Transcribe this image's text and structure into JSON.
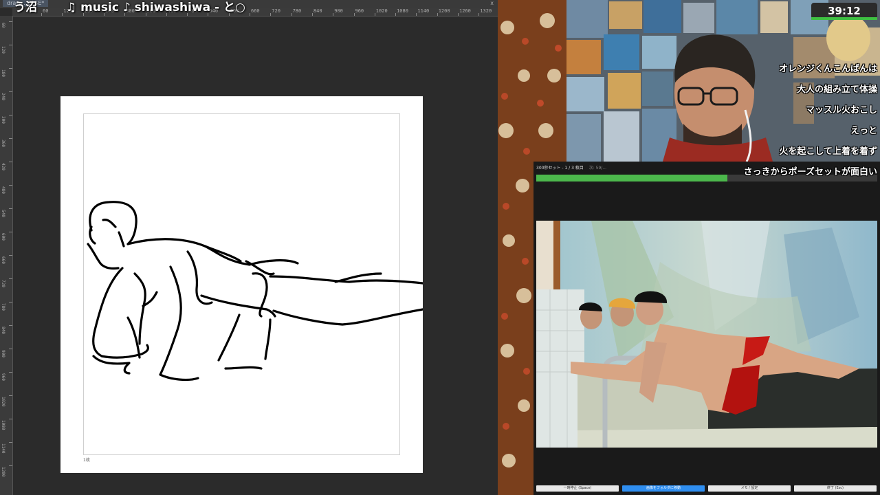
{
  "app": {
    "document_tab": "draw... BASE*",
    "tab_close": "x",
    "ruler_top_labels": [
      "60",
      "120",
      "180",
      "240",
      "300",
      "360",
      "420",
      "480",
      "540",
      "600",
      "660",
      "720",
      "780",
      "840",
      "900",
      "960",
      "1020",
      "1080",
      "1140",
      "1200",
      "1260",
      "1320"
    ],
    "ruler_left_labels": [
      "60",
      "120",
      "180",
      "240",
      "300",
      "360",
      "420",
      "480",
      "540",
      "600",
      "660",
      "720",
      "780",
      "840",
      "900",
      "960",
      "1020",
      "1080",
      "1140",
      "1200"
    ],
    "canvas_frame_label": "1枚"
  },
  "music_overlay": {
    "prefix": "う沼",
    "text": "♫ music ♪ shiwashiwa - と○"
  },
  "stream": {
    "timer": "39:12",
    "comments": [
      "オレンジくんこんばんは",
      "大人の組み立て体操",
      "マッスル火おこし",
      "えっと",
      "火を起こして上着を着ず",
      "さっきからポーズセットが面白い"
    ],
    "colors": {
      "timer_bar": "#3ec042",
      "comment_text": "#ffffff"
    }
  },
  "pose_app": {
    "header_title": "300秒セット - 1 / 3 枚目",
    "header_status": "次: 59/...",
    "progress_fraction": 0.56,
    "progress_color": "#4cb84c",
    "buttons": [
      {
        "label": "一時停止 (Space)",
        "primary": false
      },
      {
        "label": "画像をフォルダに移動",
        "primary": true
      },
      {
        "label": "メモ / 設定",
        "primary": false
      },
      {
        "label": "終了 (Esc)",
        "primary": false
      }
    ]
  }
}
